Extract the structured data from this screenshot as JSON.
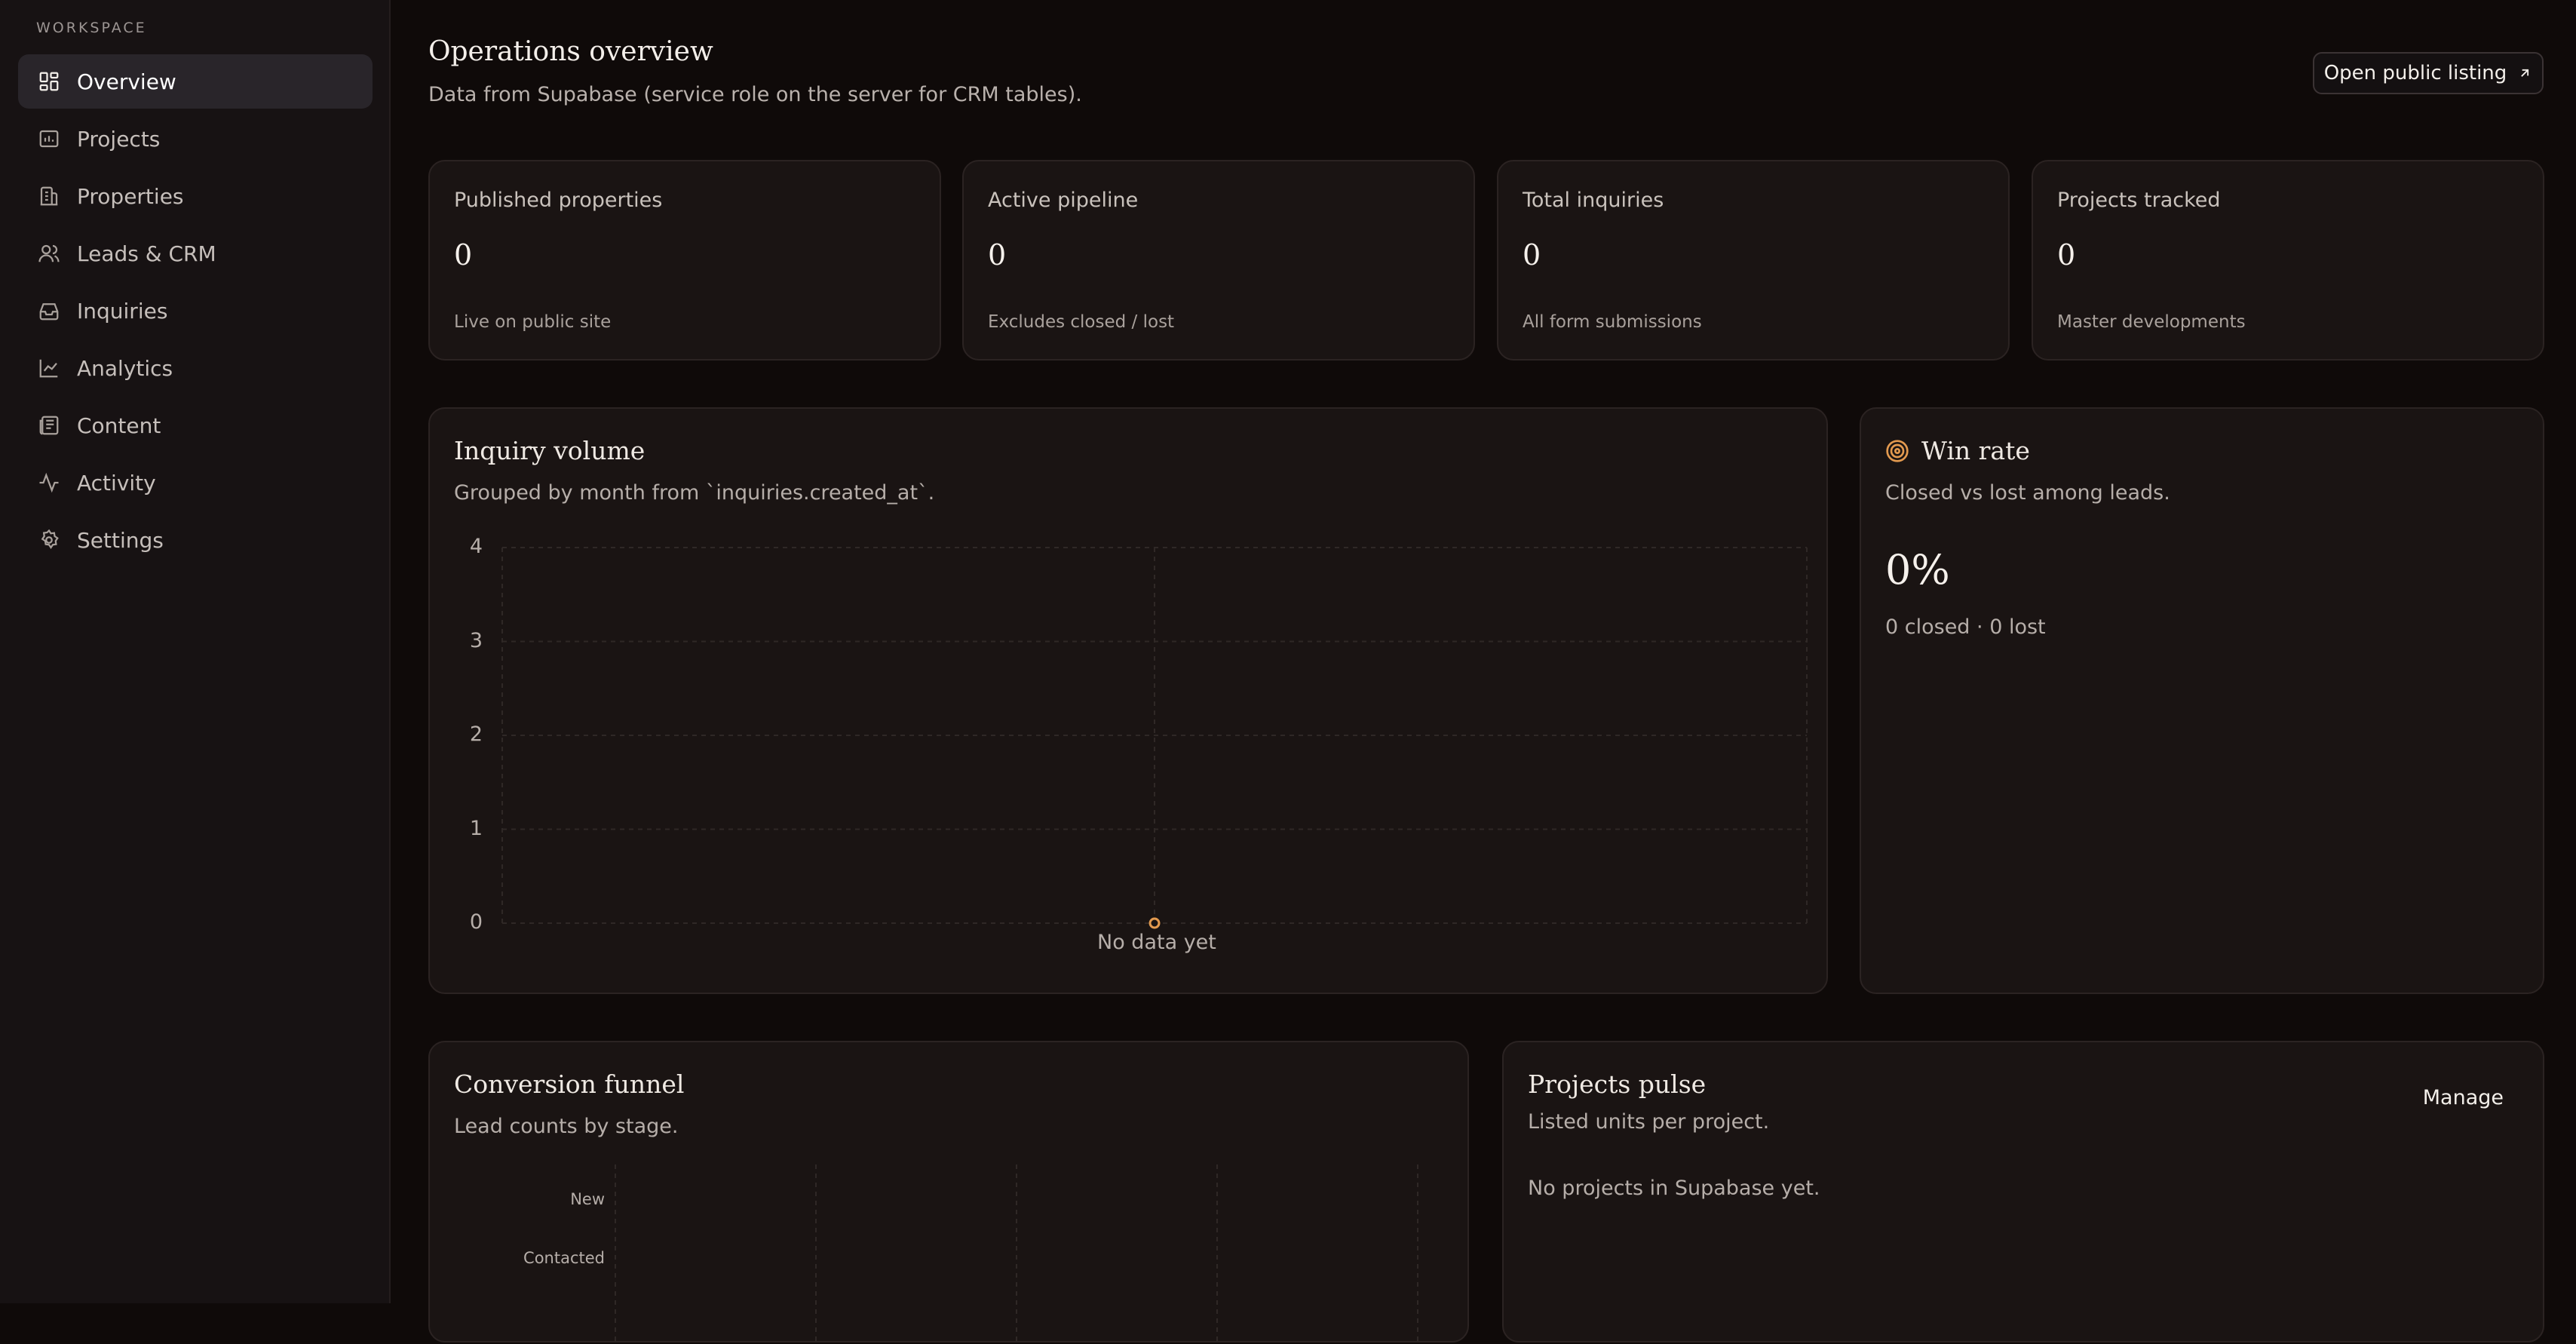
{
  "sidebar": {
    "heading": "WORKSPACE",
    "items": [
      {
        "label": "Overview",
        "icon": "layout-grid-icon",
        "active": true
      },
      {
        "label": "Projects",
        "icon": "projects-icon",
        "active": false
      },
      {
        "label": "Properties",
        "icon": "building-icon",
        "active": false
      },
      {
        "label": "Leads & CRM",
        "icon": "users-icon",
        "active": false
      },
      {
        "label": "Inquiries",
        "icon": "inbox-icon",
        "active": false
      },
      {
        "label": "Analytics",
        "icon": "line-chart-icon",
        "active": false
      },
      {
        "label": "Content",
        "icon": "newspaper-icon",
        "active": false
      },
      {
        "label": "Activity",
        "icon": "activity-icon",
        "active": false
      },
      {
        "label": "Settings",
        "icon": "gear-icon",
        "active": false
      }
    ]
  },
  "header": {
    "title": "Operations overview",
    "subtitle": "Data from Supabase (service role on the server for CRM tables).",
    "open_button": "Open public listing"
  },
  "stats": [
    {
      "label": "Published properties",
      "value": "0",
      "note": "Live on public site"
    },
    {
      "label": "Active pipeline",
      "value": "0",
      "note": "Excludes closed / lost"
    },
    {
      "label": "Total inquiries",
      "value": "0",
      "note": "All form submissions"
    },
    {
      "label": "Projects tracked",
      "value": "0",
      "note": "Master developments"
    }
  ],
  "inquiry_volume": {
    "title": "Inquiry volume",
    "subtitle": "Grouped by month from `inquiries.created_at`.",
    "empty_text": "No data yet"
  },
  "win_rate": {
    "title": "Win rate",
    "subtitle": "Closed vs lost among leads.",
    "value": "0%",
    "note": "0 closed · 0 lost",
    "icon": "target-icon",
    "accent": "#e39a4f"
  },
  "funnel": {
    "title": "Conversion funnel",
    "subtitle": "Lead counts by stage.",
    "stages": [
      "New",
      "Contacted"
    ]
  },
  "pulse": {
    "title": "Projects pulse",
    "subtitle": "Listed units per project.",
    "manage": "Manage",
    "empty_text": "No projects in Supabase yet."
  },
  "chart_data": {
    "type": "line",
    "title": "Inquiry volume",
    "x": [
      ""
    ],
    "series": [
      {
        "values": [
          0
        ]
      }
    ],
    "ylim": [
      0,
      4
    ],
    "yticks": [
      "0",
      "1",
      "2",
      "3",
      "4"
    ],
    "grid": true,
    "annotation": "No data yet"
  },
  "colors": {
    "accent": "#e39a4f",
    "background": "#0f0a09",
    "card": "#1a1413",
    "sidebar": "#171213"
  }
}
